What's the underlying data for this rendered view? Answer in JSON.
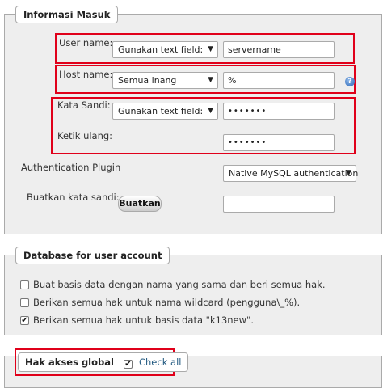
{
  "login_info": {
    "legend": "Informasi Masuk",
    "user_name": {
      "label": "User name:",
      "select": "Gunakan text field:",
      "value": "servername"
    },
    "host_name": {
      "label": "Host name:",
      "select": "Semua inang",
      "value": "%",
      "help_icon": "help-icon"
    },
    "password": {
      "label": "Kata Sandi:",
      "select": "Gunakan text field:",
      "value": "•••••••"
    },
    "retype": {
      "label": "Ketik ulang:",
      "value": "•••••••"
    },
    "auth_plugin": {
      "label": "Authentication Plugin",
      "select": "Native MySQL authentication"
    },
    "generate": {
      "label": "Buatkan kata sandi:",
      "button": "Buatkan",
      "value": ""
    }
  },
  "database": {
    "legend": "Database for user account",
    "options": [
      {
        "label": "Buat basis data dengan nama yang sama dan beri semua hak.",
        "checked": false
      },
      {
        "label": "Berikan semua hak untuk nama wildcard (pengguna\\_%).",
        "checked": false
      },
      {
        "label": "Berikan semua hak untuk basis data \"k13new\".",
        "checked": true
      }
    ]
  },
  "global_privileges": {
    "legend": "Hak akses global",
    "check_all": "Check all",
    "checked": true
  },
  "colors": {
    "highlight": "#e0001a",
    "link": "#235a81",
    "panel": "#eeeeee"
  }
}
